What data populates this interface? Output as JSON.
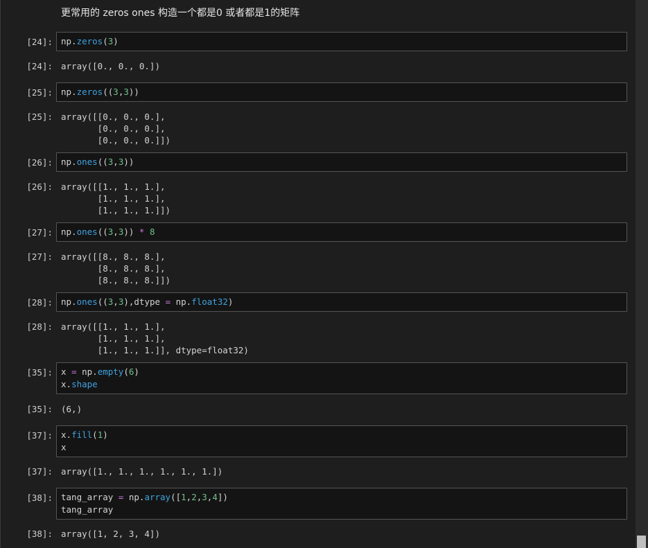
{
  "heading": "更常用的 zeros ones 构造一个都是0 或者都是1的矩阵",
  "cells": [
    {
      "in_prompt": "[24]:",
      "in_lines": [
        [
          {
            "t": "np.",
            "c": "var"
          },
          {
            "t": "zeros",
            "c": "fn"
          },
          {
            "t": "(",
            "c": "var"
          },
          {
            "t": "3",
            "c": "num"
          },
          {
            "t": ")",
            "c": "var"
          }
        ]
      ],
      "out_prompt": "[24]:",
      "out_text": "array([0., 0., 0.])"
    },
    {
      "in_prompt": "[25]:",
      "in_lines": [
        [
          {
            "t": "np.",
            "c": "var"
          },
          {
            "t": "zeros",
            "c": "fn"
          },
          {
            "t": "((",
            "c": "var"
          },
          {
            "t": "3",
            "c": "num"
          },
          {
            "t": ",",
            "c": "var"
          },
          {
            "t": "3",
            "c": "num"
          },
          {
            "t": "))",
            "c": "var"
          }
        ]
      ],
      "out_prompt": "[25]:",
      "out_text": "array([[0., 0., 0.],\n       [0., 0., 0.],\n       [0., 0., 0.]])"
    },
    {
      "in_prompt": "[26]:",
      "in_lines": [
        [
          {
            "t": "np.",
            "c": "var"
          },
          {
            "t": "ones",
            "c": "fn"
          },
          {
            "t": "((",
            "c": "var"
          },
          {
            "t": "3",
            "c": "num"
          },
          {
            "t": ",",
            "c": "var"
          },
          {
            "t": "3",
            "c": "num"
          },
          {
            "t": "))",
            "c": "var"
          }
        ]
      ],
      "out_prompt": "[26]:",
      "out_text": "array([[1., 1., 1.],\n       [1., 1., 1.],\n       [1., 1., 1.]])"
    },
    {
      "in_prompt": "[27]:",
      "in_lines": [
        [
          {
            "t": "np.",
            "c": "var"
          },
          {
            "t": "ones",
            "c": "fn"
          },
          {
            "t": "((",
            "c": "var"
          },
          {
            "t": "3",
            "c": "num"
          },
          {
            "t": ",",
            "c": "var"
          },
          {
            "t": "3",
            "c": "num"
          },
          {
            "t": ")) ",
            "c": "var"
          },
          {
            "t": "*",
            "c": "op"
          },
          {
            "t": " ",
            "c": "var"
          },
          {
            "t": "8",
            "c": "num"
          }
        ]
      ],
      "out_prompt": "[27]:",
      "out_text": "array([[8., 8., 8.],\n       [8., 8., 8.],\n       [8., 8., 8.]])"
    },
    {
      "in_prompt": "[28]:",
      "in_lines": [
        [
          {
            "t": "np.",
            "c": "var"
          },
          {
            "t": "ones",
            "c": "fn"
          },
          {
            "t": "((",
            "c": "var"
          },
          {
            "t": "3",
            "c": "num"
          },
          {
            "t": ",",
            "c": "var"
          },
          {
            "t": "3",
            "c": "num"
          },
          {
            "t": "),dtype ",
            "c": "var"
          },
          {
            "t": "=",
            "c": "op"
          },
          {
            "t": " np.",
            "c": "var"
          },
          {
            "t": "float32",
            "c": "fn"
          },
          {
            "t": ")",
            "c": "var"
          }
        ]
      ],
      "out_prompt": "[28]:",
      "out_text": "array([[1., 1., 1.],\n       [1., 1., 1.],\n       [1., 1., 1.]], dtype=float32)"
    },
    {
      "in_prompt": "[35]:",
      "in_lines": [
        [
          {
            "t": "x ",
            "c": "var"
          },
          {
            "t": "=",
            "c": "op"
          },
          {
            "t": " np.",
            "c": "var"
          },
          {
            "t": "empty",
            "c": "fn"
          },
          {
            "t": "(",
            "c": "var"
          },
          {
            "t": "6",
            "c": "num"
          },
          {
            "t": ")",
            "c": "var"
          }
        ],
        [
          {
            "t": "x.",
            "c": "var"
          },
          {
            "t": "shape",
            "c": "fn"
          }
        ]
      ],
      "out_prompt": "[35]:",
      "out_text": "(6,)"
    },
    {
      "in_prompt": "[37]:",
      "in_lines": [
        [
          {
            "t": "x.",
            "c": "var"
          },
          {
            "t": "fill",
            "c": "fn"
          },
          {
            "t": "(",
            "c": "var"
          },
          {
            "t": "1",
            "c": "num"
          },
          {
            "t": ")",
            "c": "var"
          }
        ],
        [
          {
            "t": "x",
            "c": "var"
          }
        ]
      ],
      "out_prompt": "[37]:",
      "out_text": "array([1., 1., 1., 1., 1., 1.])"
    },
    {
      "in_prompt": "[38]:",
      "in_lines": [
        [
          {
            "t": "tang_array ",
            "c": "var"
          },
          {
            "t": "=",
            "c": "op"
          },
          {
            "t": " np.",
            "c": "var"
          },
          {
            "t": "array",
            "c": "fn"
          },
          {
            "t": "([",
            "c": "var"
          },
          {
            "t": "1",
            "c": "num"
          },
          {
            "t": ",",
            "c": "var"
          },
          {
            "t": "2",
            "c": "num"
          },
          {
            "t": ",",
            "c": "var"
          },
          {
            "t": "3",
            "c": "num"
          },
          {
            "t": ",",
            "c": "var"
          },
          {
            "t": "4",
            "c": "num"
          },
          {
            "t": "])",
            "c": "var"
          }
        ],
        [
          {
            "t": "tang_array",
            "c": "var"
          }
        ]
      ],
      "out_prompt": "[38]:",
      "out_text": "array([1, 2, 3, 4])"
    }
  ]
}
